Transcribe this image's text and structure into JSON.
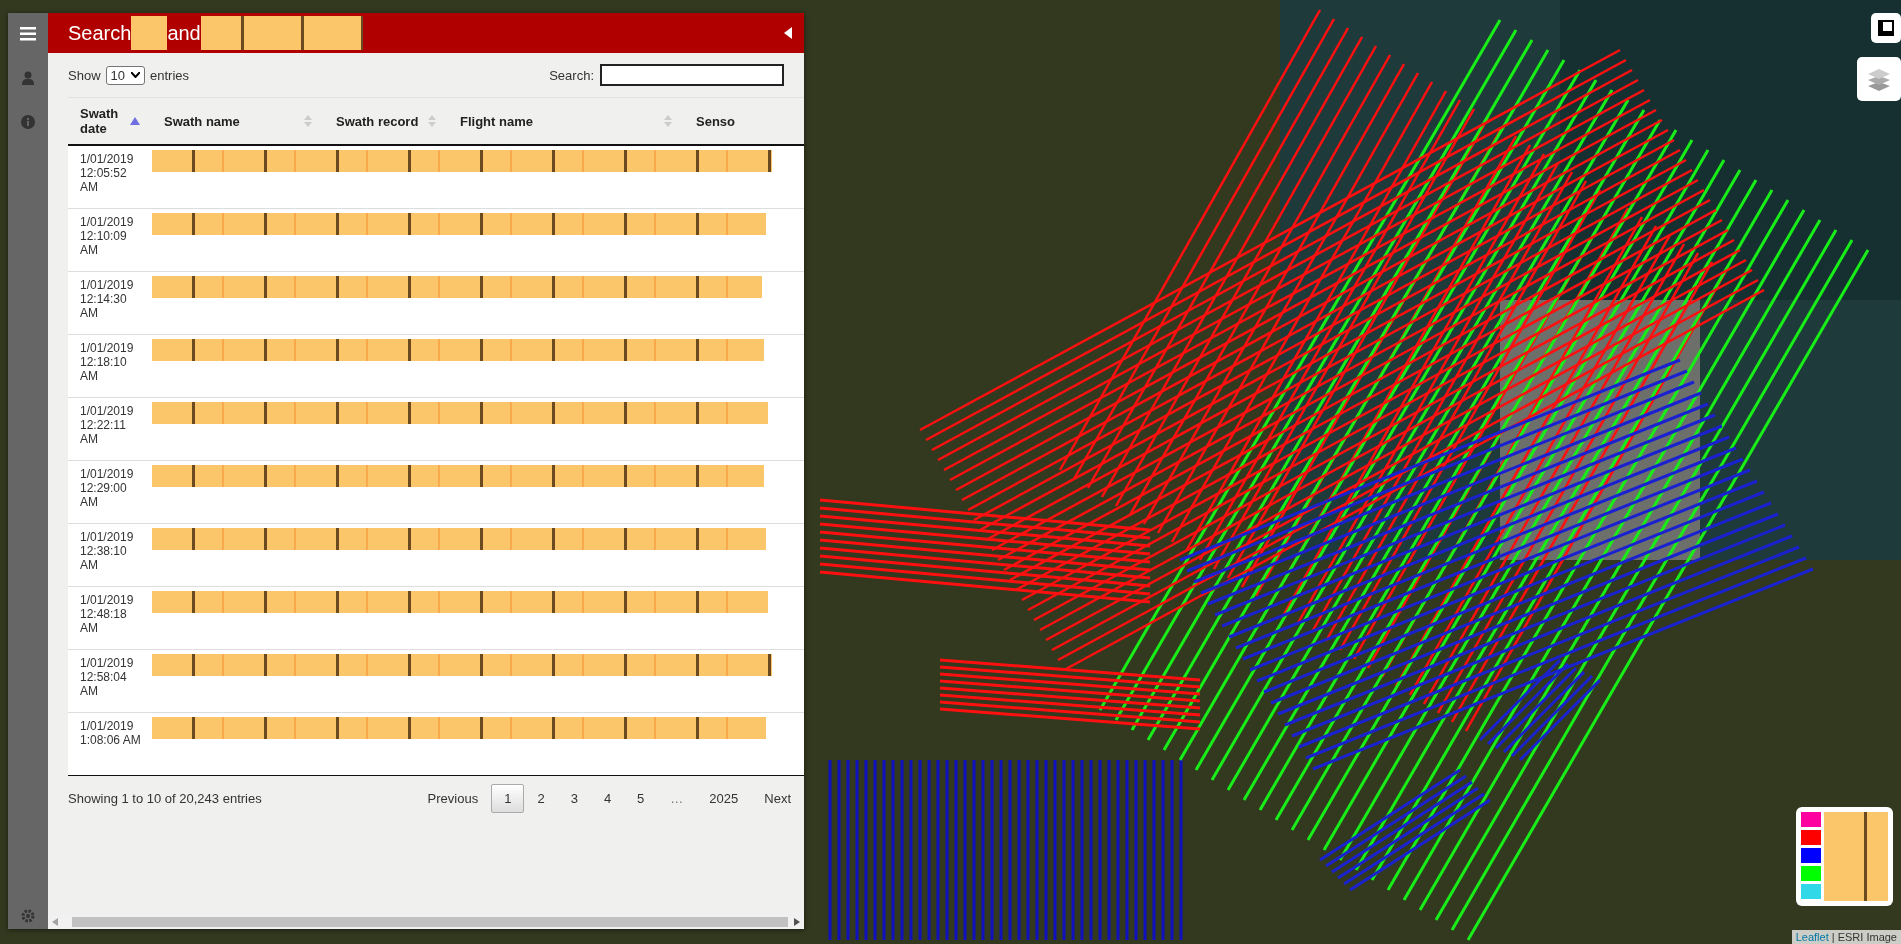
{
  "panel": {
    "title_parts": [
      {
        "kind": "text",
        "text": "Search"
      },
      {
        "kind": "redacted"
      },
      {
        "kind": "text",
        "text": "and"
      },
      {
        "kind": "redacted"
      },
      {
        "kind": "redacted"
      },
      {
        "kind": "redacted"
      }
    ]
  },
  "length_menu": {
    "before": "Show",
    "value": "10",
    "after": "entries"
  },
  "search": {
    "label": "Search:"
  },
  "table": {
    "columns": [
      {
        "label": "Swath date",
        "sorted": true
      },
      {
        "label": "Swath name",
        "sorted": false
      },
      {
        "label": "Swath record",
        "sorted": false
      },
      {
        "label": "Flight name",
        "sorted": false
      },
      {
        "label": "Senso"
      }
    ],
    "rows": [
      {
        "date": "1/01/2019 12:05:52 AM"
      },
      {
        "date": "1/01/2019 12:10:09 AM"
      },
      {
        "date": "1/01/2019 12:14:30 AM"
      },
      {
        "date": "1/01/2019 12:18:10 AM"
      },
      {
        "date": "1/01/2019 12:22:11 AM"
      },
      {
        "date": "1/01/2019 12:29:00 AM"
      },
      {
        "date": "1/01/2019 12:38:10 AM"
      },
      {
        "date": "1/01/2019 12:48:18 AM"
      },
      {
        "date": "1/01/2019 12:58:04 AM"
      },
      {
        "date": "1/01/2019 1:08:06 AM"
      }
    ]
  },
  "info": "Showing 1 to 10 of 20,243 entries",
  "pagination": [
    {
      "label": "Previous",
      "kind": "nav",
      "selected": false
    },
    {
      "label": "1",
      "kind": "page",
      "selected": true
    },
    {
      "label": "2",
      "kind": "page",
      "selected": false
    },
    {
      "label": "3",
      "kind": "page",
      "selected": false
    },
    {
      "label": "4",
      "kind": "page",
      "selected": false
    },
    {
      "label": "5",
      "kind": "page",
      "selected": false
    },
    {
      "label": "…",
      "kind": "ellipsis",
      "selected": false
    },
    {
      "label": "2025",
      "kind": "page",
      "selected": false
    },
    {
      "label": "Next",
      "kind": "nav",
      "selected": false
    }
  ],
  "legend": [
    {
      "color": "#ff00a0"
    },
    {
      "color": "#ff0000"
    },
    {
      "color": "#0000ff"
    },
    {
      "color": "#00ff00"
    },
    {
      "color": "#30d8e8"
    }
  ],
  "attribution": {
    "link": "Leaflet",
    "separator": "|",
    "text": "ESRI Image"
  }
}
